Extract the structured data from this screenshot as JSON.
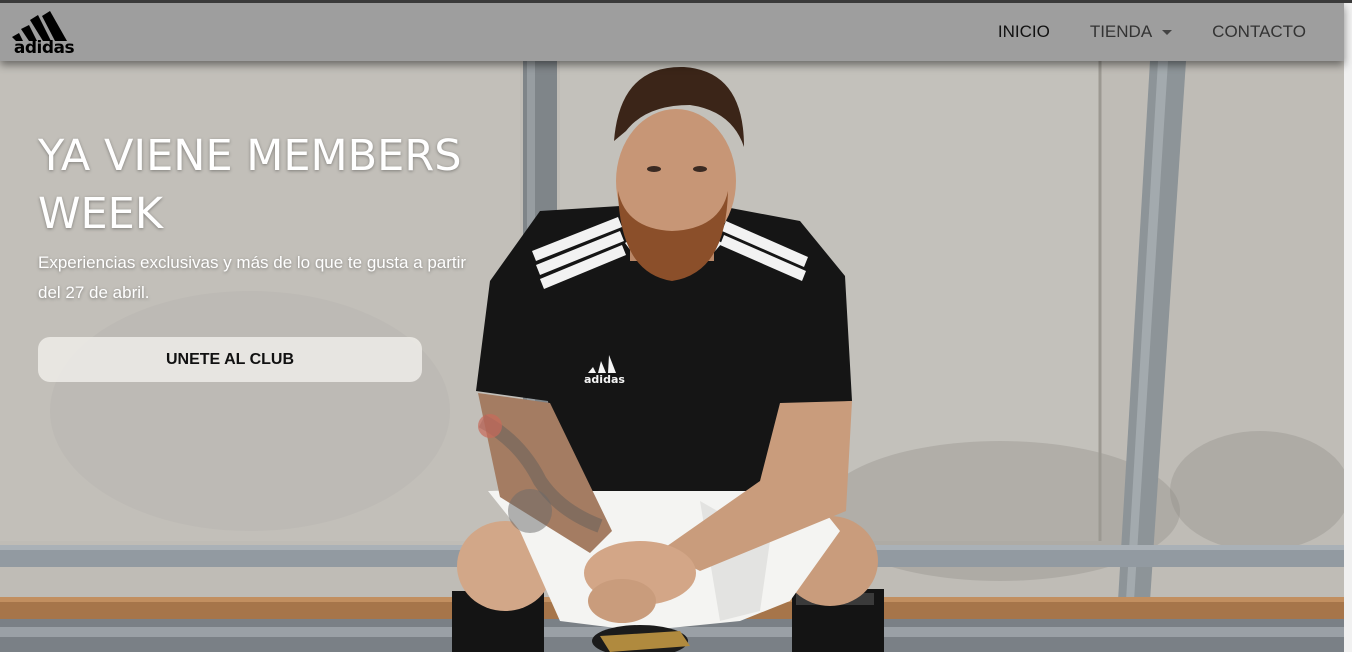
{
  "brand": {
    "logo_text": "adidas",
    "logo_icon": "adidas-mountain-stripes-icon"
  },
  "nav": {
    "items": [
      {
        "label": "INICIO",
        "active": true
      },
      {
        "label": "TIENDA",
        "has_dropdown": true
      },
      {
        "label": "CONTACTO"
      }
    ],
    "dropdown_icon": "caret-down-icon"
  },
  "hero": {
    "title": "YA VIENE MEMBERS WEEK",
    "subtitle": "Experiencias exclusivas y más de lo que te gusta a partir del 27 de abril.",
    "cta_label": "UNETE AL CLUB",
    "jersey_logo_text": "adidas"
  },
  "colors": {
    "navbar_bg": "#9e9e9e",
    "hero_text": "#ffffff",
    "jersey": "#151515"
  }
}
